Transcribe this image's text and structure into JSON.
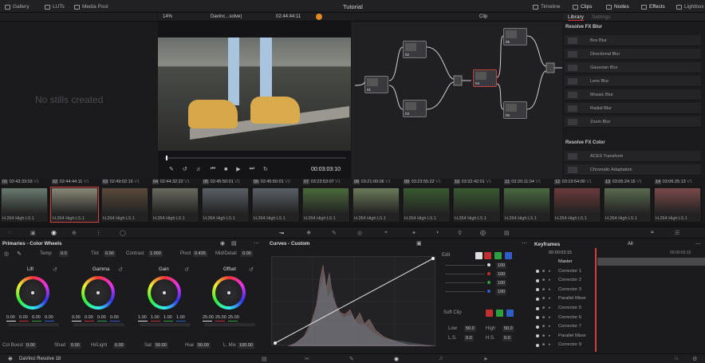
{
  "topbar": {
    "left": [
      "Gallery",
      "LUTs",
      "Media Pool"
    ],
    "title": "Tutorial",
    "right": [
      "Timeline",
      "Clips",
      "Nodes",
      "Effects",
      "Lightbox"
    ]
  },
  "viewer": {
    "zoom": "14%",
    "clip_name": "Davinc...solve)",
    "timecode": "02:44:44:11",
    "current_time": "00:03:03:10"
  },
  "gallery": {
    "empty_text": "No stills created"
  },
  "nodes": {
    "mode": "Clip",
    "labels": [
      "01",
      "02",
      "03",
      "04",
      "05",
      "06",
      "07"
    ]
  },
  "library": {
    "tabs": [
      "Library",
      "Settings"
    ],
    "blur_header": "Resolve FX Blur",
    "blur_items": [
      "Box Blur",
      "Directional Blur",
      "Gaussian Blur",
      "Lens Blur",
      "Mosaic Blur",
      "Radial Blur",
      "Zoom Blur"
    ],
    "color_header": "Resolve FX Color",
    "color_items": [
      "ACES Transform",
      "Chromatic Adaptation"
    ]
  },
  "clips": [
    {
      "num": "01",
      "tc": "02:43:33:03",
      "v": "V1",
      "fmt": "H.264 High L5.1",
      "color": "#6a7a70"
    },
    {
      "num": "02",
      "tc": "02:44:44:11",
      "v": "V1",
      "fmt": "H.264 High L5.1",
      "color": "#8a8878"
    },
    {
      "num": "03",
      "tc": "02:49:02:16",
      "v": "V1",
      "fmt": "H.264 High L5.1",
      "color": "#5a4a3a"
    },
    {
      "num": "04",
      "tc": "02:44:32:22",
      "v": "V1",
      "fmt": "H.264 High L5.1",
      "color": "#6a6a60"
    },
    {
      "num": "05",
      "tc": "02:45:50:01",
      "v": "V1",
      "fmt": "H.264 High L5.1",
      "color": "#5a6068"
    },
    {
      "num": "06",
      "tc": "02:45:50:01",
      "v": "V2",
      "fmt": "H.264 High L5.1",
      "color": "#5a6068"
    },
    {
      "num": "07",
      "tc": "03:23:53:07",
      "v": "V1",
      "fmt": "H.264 High L5.1",
      "color": "#4a6a3a"
    },
    {
      "num": "08",
      "tc": "03:21:00:06",
      "v": "V1",
      "fmt": "H.264 High L5.1",
      "color": "#6a7a5a"
    },
    {
      "num": "09",
      "tc": "03:23:55:22",
      "v": "V1",
      "fmt": "H.264 High L5.1",
      "color": "#3a5a30"
    },
    {
      "num": "10",
      "tc": "03:32:42:01",
      "v": "V1",
      "fmt": "H.264 High L5.1",
      "color": "#3a5a32"
    },
    {
      "num": "11",
      "tc": "03:20:11:04",
      "v": "V1",
      "fmt": "H.264 High L5.1",
      "color": "#4a6a40"
    },
    {
      "num": "12",
      "tc": "03:19:54:00",
      "v": "V1",
      "fmt": "H.264 High L5.1",
      "color": "#6a3a3a"
    },
    {
      "num": "13",
      "tc": "03:05:24:15",
      "v": "V1",
      "fmt": "H.264 High L5.1",
      "color": "#5a6a50"
    },
    {
      "num": "14",
      "tc": "03:06:25:13",
      "v": "V1",
      "fmt": "H.264 High L5.1",
      "color": "#7a4a4a"
    }
  ],
  "primaries": {
    "title": "Primaries - Color Wheels",
    "temp_label": "Temp",
    "temp": "0.0",
    "tint_label": "Tint",
    "tint": "0.00",
    "contrast_label": "Contrast",
    "contrast": "1.000",
    "pivot_label": "Pivot",
    "pivot": "0.435",
    "middetail_label": "Mid/Detail",
    "middetail": "0.00",
    "wheels": [
      {
        "name": "Lift",
        "vals": [
          "0.00",
          "0.00",
          "0.00",
          "0.00"
        ]
      },
      {
        "name": "Gamma",
        "vals": [
          "0.00",
          "0.00",
          "0.00",
          "0.00"
        ]
      },
      {
        "name": "Gain",
        "vals": [
          "1.00",
          "1.00",
          "1.00",
          "1.00"
        ]
      },
      {
        "name": "Offset",
        "vals": [
          "25.00",
          "25.00",
          "25.00"
        ]
      }
    ],
    "colboost_label": "Col Boost",
    "colboost": "0.00",
    "shad_label": "Shad",
    "shad": "0.00",
    "hilight_label": "Hi/Light",
    "hilight": "0.00",
    "sat_label": "Sat",
    "sat": "50.00",
    "hue_label": "Hue",
    "hue": "50.00",
    "lmix_label": "L. Mix",
    "lmix": "100.00"
  },
  "curves": {
    "title": "Curves - Custom",
    "edit_label": "Edit",
    "edit_vals": [
      "100",
      "100",
      "100",
      "100"
    ],
    "softclip_label": "Soft Clip",
    "low_label": "Low",
    "low": "50.0",
    "high_label": "High",
    "high": "50.0",
    "ls_label": "L.S.",
    "ls": "0.0",
    "hs_label": "H.S.",
    "hs": "0.0"
  },
  "keyframes": {
    "title": "Keyframes",
    "filter": "All",
    "time": "00:00:03:15",
    "end_time": "00:00:03:15",
    "items": [
      "Master",
      "Corrector 1",
      "Corrector 2",
      "Corrector 3",
      "Parallel Mixer",
      "Corrector 5",
      "Corrector 6",
      "Corrector 7",
      "Parallel Mixer",
      "Corrector 9"
    ]
  },
  "footer": {
    "app": "DaVinci Resolve 18"
  }
}
